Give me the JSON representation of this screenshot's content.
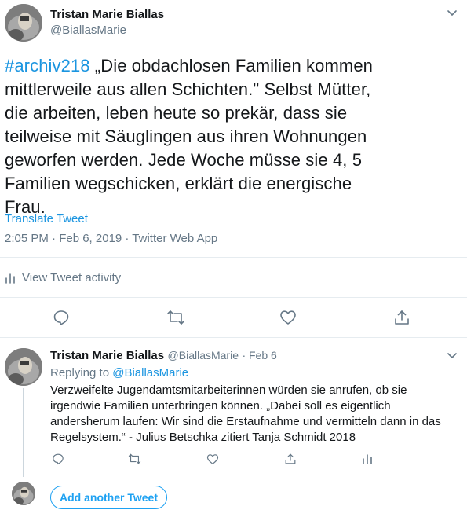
{
  "main_tweet": {
    "author_name": "Tristan Marie Biallas",
    "author_handle": "@BiallasMarie",
    "hashtag": "#archiv218",
    "text_after_hashtag": " „Die obdachlosen Familien kommen mittlerweile aus allen Schichten.\" Selbst Mütter, die arbeiten, leben heute so prekär, dass sie teilweise mit Säuglingen aus ihren Wohnungen geworfen werden. Jede Woche müsse sie 4, 5 Familien wegschicken, erklärt die energische Frau.",
    "translate_label": "Translate Tweet",
    "timestamp": "2:05 PM · Feb 6, 2019 · Twitter Web App",
    "activity_label": "View Tweet activity"
  },
  "reply_tweet": {
    "author_name": "Tristan Marie Biallas",
    "author_handle": "@BiallasMarie",
    "date": "· Feb 6",
    "replying_prefix": "Replying to ",
    "replying_handle": "@BiallasMarie",
    "text": "Verzweifelte Jugendamtsmitarbeiterinnen würden sie anrufen, ob sie irgendwie Familien unterbringen können. „Dabei soll es eigentlich andersherum laufen: Wir sind die Erstaufnahme und vermitteln dann in das Regelsystem.“ - Julius Betschka zitiert Tanja Schmidt 2018"
  },
  "add_tweet_label": "Add another Tweet",
  "icons": {
    "reply": "reply-icon",
    "retweet": "retweet-icon",
    "like": "like-icon",
    "share": "share-icon",
    "analytics": "analytics-icon",
    "chevron": "chevron-down-icon"
  },
  "colors": {
    "accent": "#1da1f2",
    "link": "#1b95e0",
    "muted": "#657786",
    "divider": "#e6ecf0"
  }
}
